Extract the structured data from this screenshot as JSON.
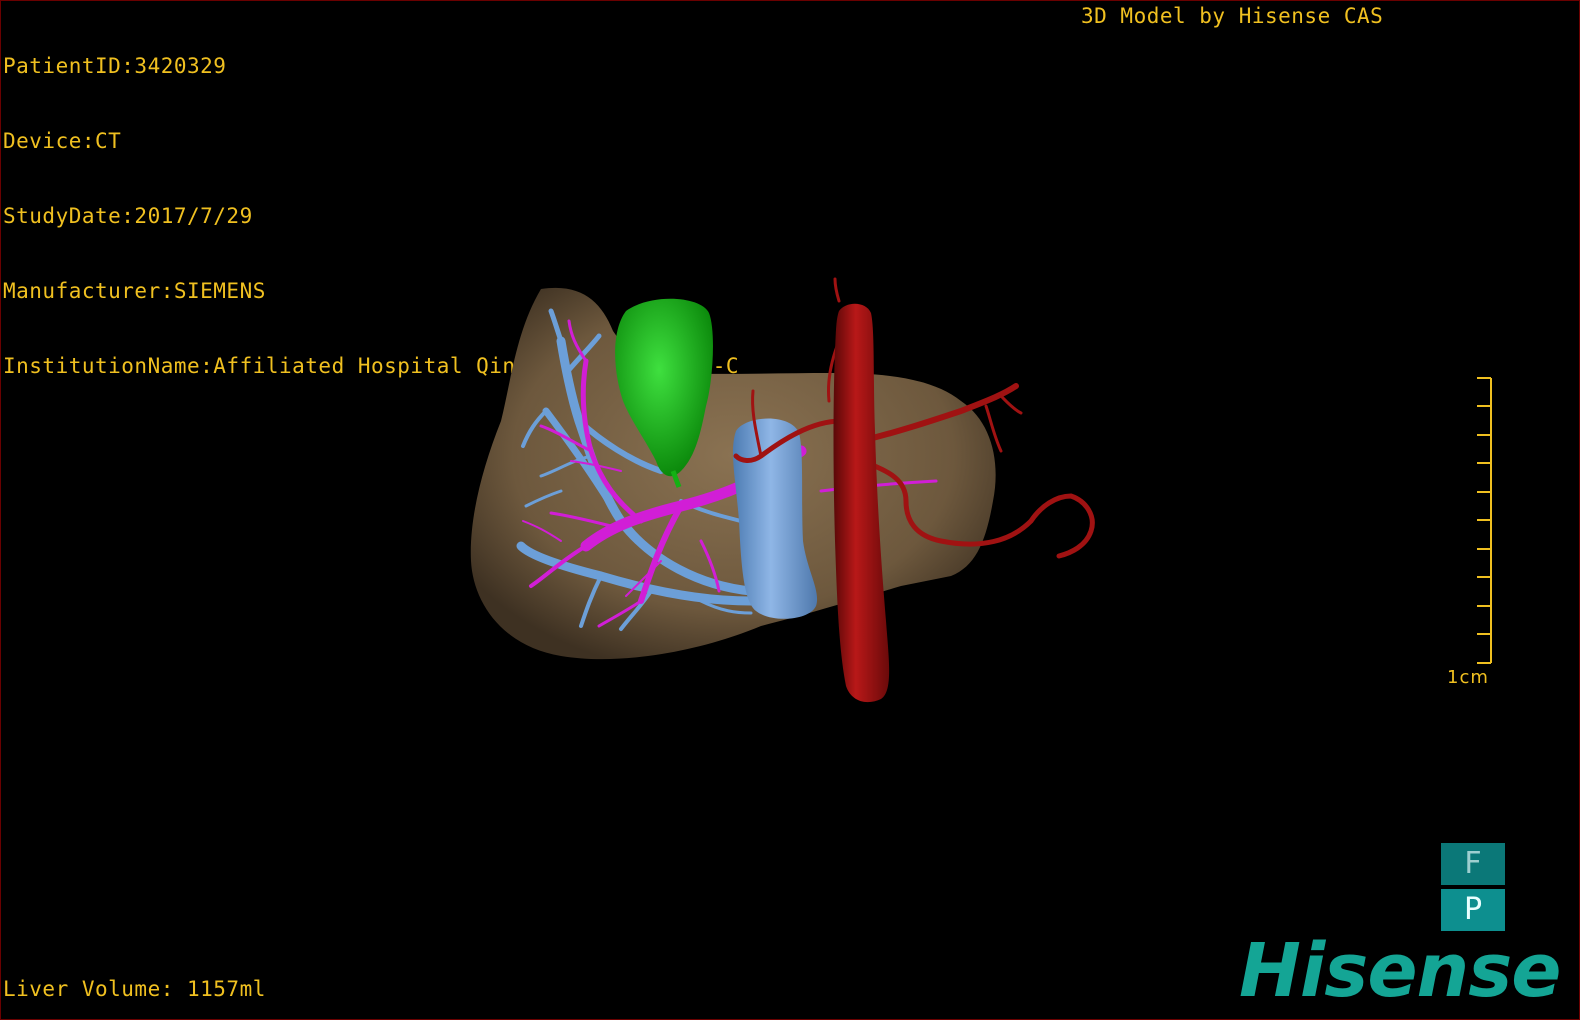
{
  "header": {
    "patient_id": "PatientID:3420329",
    "device": "Device:CT",
    "study_date": "StudyDate:2017/7/29",
    "manufacturer": "Manufacturer:SIEMENS",
    "institution": "InstitutionName:Affiliated Hospital Qingdao University-C",
    "watermark": "3D Model by Hisense CAS"
  },
  "footer": {
    "liver_volume": "Liver Volume: 1157ml"
  },
  "scale": {
    "label": "1cm",
    "ticks": 11
  },
  "orientation": {
    "top_face": "F",
    "front_face": "P"
  },
  "brand": {
    "logo": "Hisense"
  },
  "colors": {
    "text": "#f0c020",
    "liver": "#7a6447",
    "portal_vein": "#d11ed6",
    "hepatic_vein": "#6c9fd8",
    "artery_aorta": "#a01212",
    "gallbladder": "#1bb81b",
    "brand": "#14a595"
  }
}
